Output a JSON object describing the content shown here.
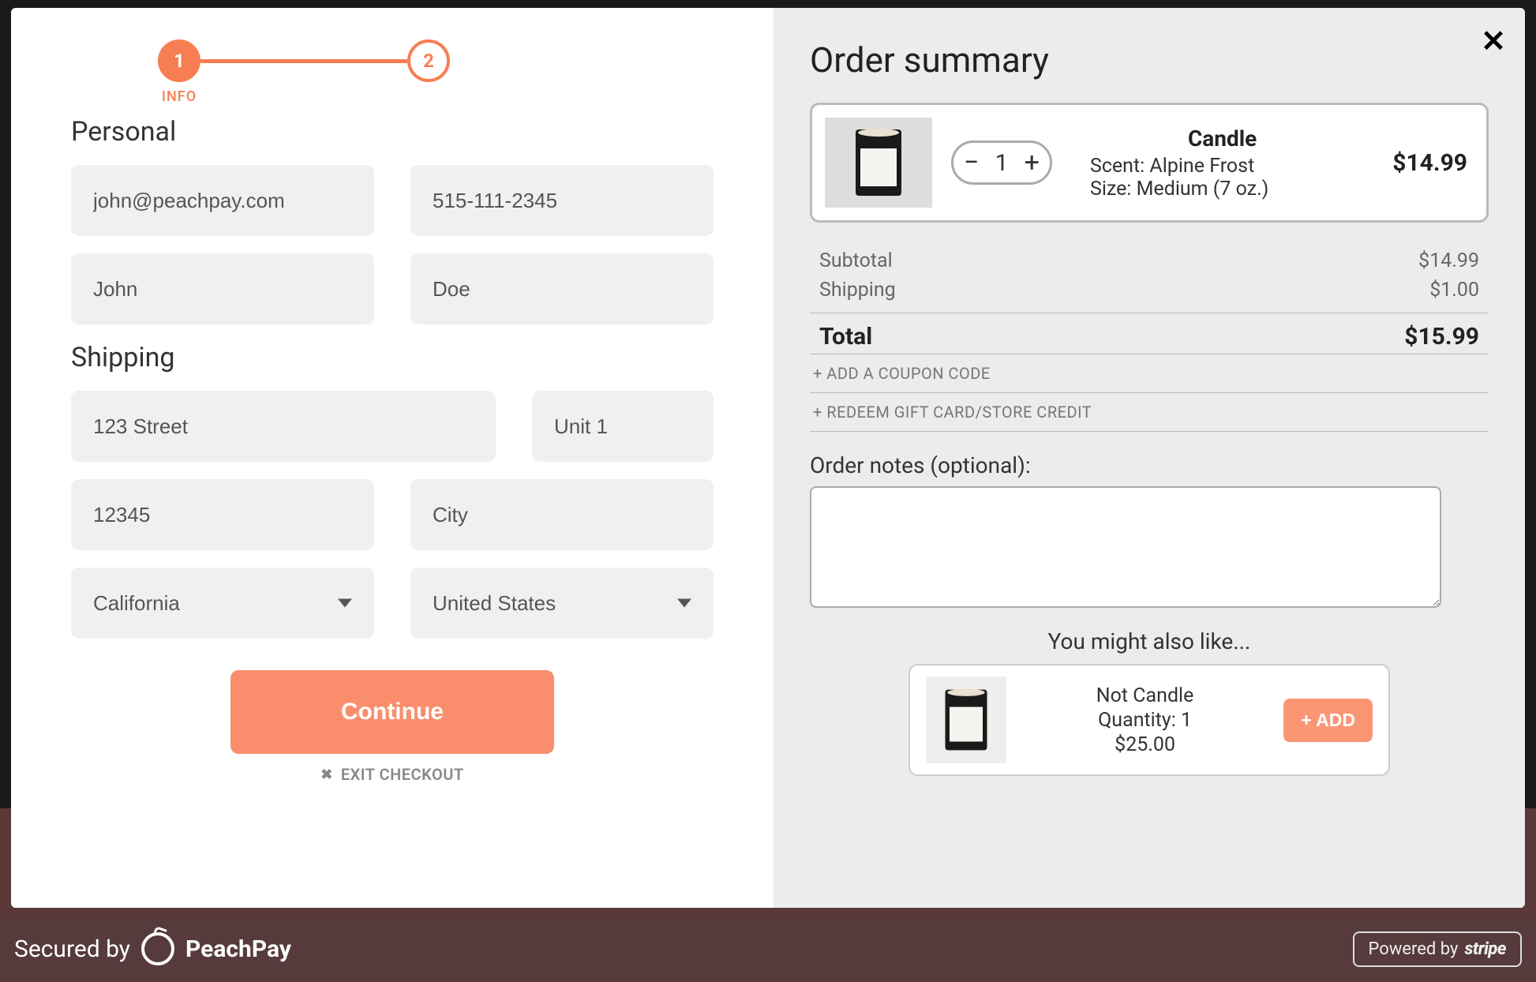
{
  "stepper": {
    "step1": "1",
    "step2": "2",
    "label1": "INFO"
  },
  "personal": {
    "title": "Personal",
    "email": "john@peachpay.com",
    "phone": "515-111-2345",
    "first_name": "John",
    "last_name": "Doe"
  },
  "shipping": {
    "title": "Shipping",
    "address1": "123 Street",
    "address2": "Unit 1",
    "zip": "12345",
    "city": "City",
    "state": "California",
    "country": "United States"
  },
  "buttons": {
    "continue": "Continue",
    "exit": "EXIT CHECKOUT"
  },
  "summary": {
    "title": "Order summary",
    "item": {
      "name": "Candle",
      "scent": "Scent: Alpine Frost",
      "size": "Size: Medium (7 oz.)",
      "qty": "1",
      "price": "$14.99"
    },
    "subtotal_label": "Subtotal",
    "subtotal": "$14.99",
    "shipping_label": "Shipping",
    "shipping": "$1.00",
    "total_label": "Total",
    "total": "$15.99",
    "coupon": "+ ADD A COUPON CODE",
    "giftcard": "+ REDEEM GIFT CARD/STORE CREDIT",
    "notes_label": "Order notes (optional):",
    "suggest_title": "You might also like...",
    "suggest": {
      "name": "Not Candle",
      "qty": "Quantity: 1",
      "price": "$25.00",
      "add": "+ ADD"
    }
  },
  "footer": {
    "secured": "Secured by",
    "brand": "PeachPay",
    "powered": "Powered by",
    "stripe": "stripe"
  }
}
